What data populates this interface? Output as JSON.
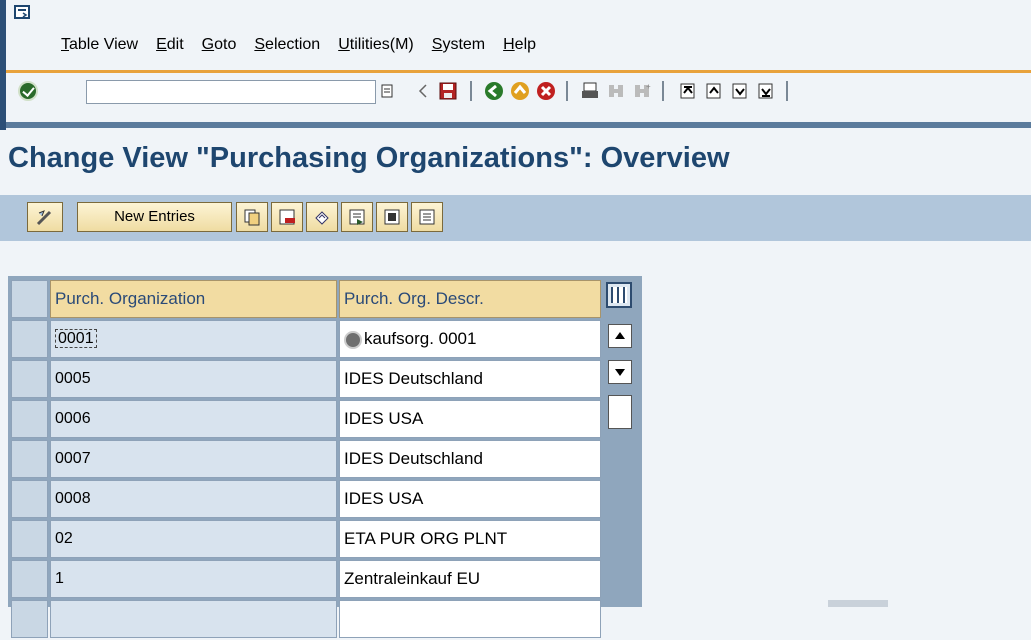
{
  "menubar": {
    "items": [
      "Table View",
      "Edit",
      "Goto",
      "Selection",
      "Utilities(M)",
      "System",
      "Help"
    ]
  },
  "toolbar": {
    "command_field_value": "",
    "icons": [
      "enter-icon",
      "command-dropdown-icon",
      "back-arrow-icon",
      "save-icon",
      "back-icon",
      "exit-icon",
      "cancel-icon",
      "print-icon",
      "find-icon",
      "find-next-icon",
      "first-page-icon",
      "previous-page-icon",
      "next-page-icon",
      "last-page-icon"
    ]
  },
  "page": {
    "title": "Change View \"Purchasing Organizations\": Overview"
  },
  "app_toolbar": {
    "new_entries_label": "New Entries",
    "icons": [
      "display-change-icon",
      "copy-as-icon",
      "delete-icon",
      "undo-change-icon",
      "select-all-icon",
      "select-block-icon",
      "deselect-all-icon"
    ]
  },
  "table": {
    "columns": [
      "Purch. Organization",
      "Purch. Org. Descr."
    ],
    "rows": [
      {
        "key": "0001",
        "desc": "kaufsorg. 0001"
      },
      {
        "key": "0005",
        "desc": "IDES Deutschland"
      },
      {
        "key": "0006",
        "desc": "IDES USA"
      },
      {
        "key": "0007",
        "desc": "IDES Deutschland"
      },
      {
        "key": "0008",
        "desc": "IDES USA"
      },
      {
        "key": "02",
        "desc": "ETA PUR ORG PLNT"
      },
      {
        "key": "1",
        "desc": "Zentraleinkauf EU"
      },
      {
        "key": "",
        "desc": ""
      }
    ]
  },
  "colors": {
    "title": "#1e466f",
    "accent_line": "#e8a23c",
    "app_toolbar_bg": "#b1c6db",
    "header_cell": "#f2dca2"
  }
}
